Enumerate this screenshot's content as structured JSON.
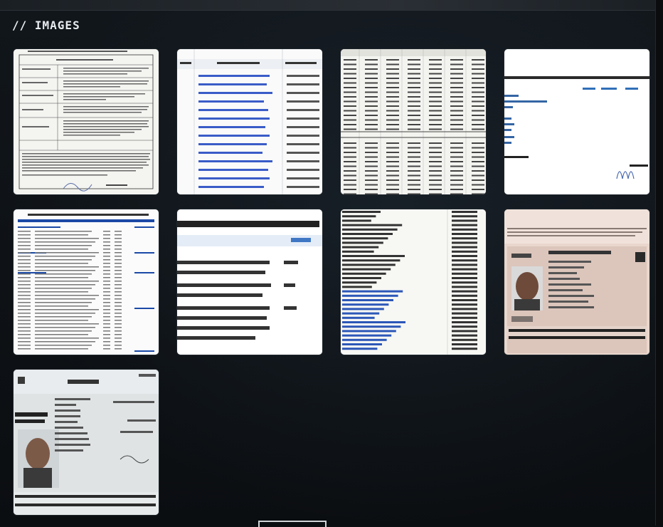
{
  "section": {
    "title": "// IMAGES"
  },
  "images": [
    {
      "id": "contract-doc"
    },
    {
      "id": "email-list"
    },
    {
      "id": "spreadsheet-table"
    },
    {
      "id": "expansion-header"
    },
    {
      "id": "budget-doc"
    },
    {
      "id": "office-quote"
    },
    {
      "id": "balance-sheet"
    },
    {
      "id": "mexican-passport"
    },
    {
      "id": "spanish-passport"
    }
  ],
  "colors": {
    "background": "#0c0f12",
    "title": "#e8ecef"
  }
}
